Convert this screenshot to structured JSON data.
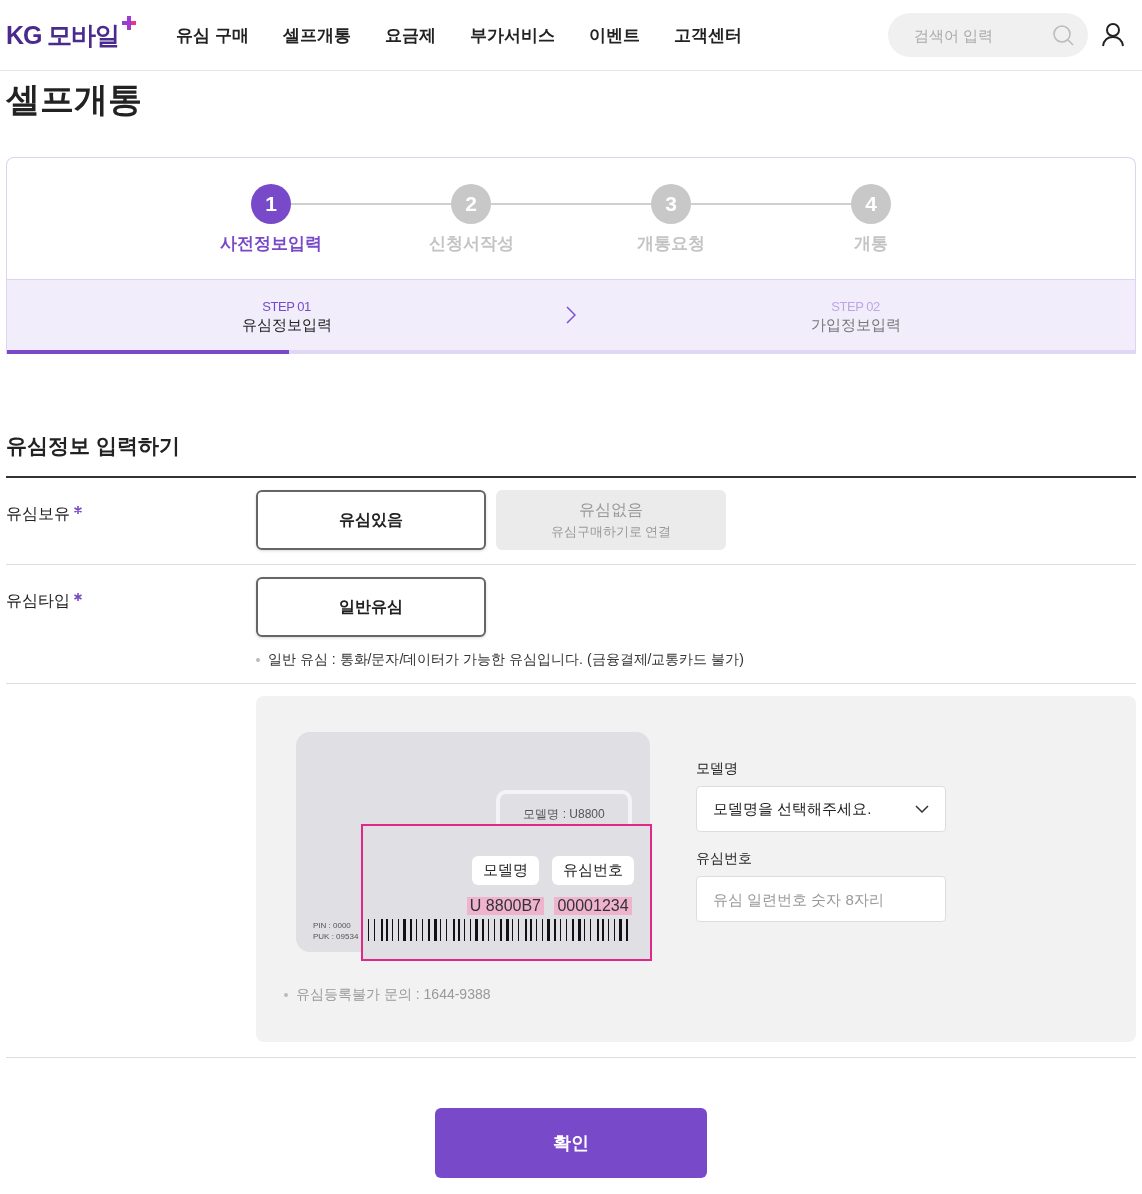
{
  "header": {
    "logo": {
      "text": "KG 모바일"
    },
    "nav": [
      {
        "label": "유심 구매"
      },
      {
        "label": "셀프개통"
      },
      {
        "label": "요금제"
      },
      {
        "label": "부가서비스"
      },
      {
        "label": "이벤트"
      },
      {
        "label": "고객센터"
      }
    ],
    "search": {
      "placeholder": "검색어 입력"
    }
  },
  "page_title": "셀프개통",
  "steps": [
    {
      "number": "1",
      "label": "사전정보입력",
      "selected": true
    },
    {
      "number": "2",
      "label": "신청서작성",
      "selected": false
    },
    {
      "number": "3",
      "label": "개통요청",
      "selected": false
    },
    {
      "number": "4",
      "label": "개통",
      "selected": false
    }
  ],
  "substeps": {
    "level": 0.25,
    "items": [
      {
        "step": "STEP 01",
        "label": "유심정보입력",
        "selected": true
      },
      {
        "step": "STEP 02",
        "label": "가입정보입력",
        "selected": false
      }
    ]
  },
  "section_title": "유심정보 입력하기",
  "form_rows": [
    {
      "label": "유심보유",
      "required": true,
      "options": [
        {
          "label": "유심있음",
          "selected": true,
          "disabled": false
        },
        {
          "label": "유심없음",
          "sublabel": "유심구매하기로 연결",
          "selected": false,
          "disabled": true
        }
      ]
    },
    {
      "label": "유심타입",
      "required": true,
      "options": [
        {
          "label": "일반유심",
          "selected": true,
          "disabled": false
        }
      ],
      "note": "일반 유심 : 통화/문자/데이터가 가능한 유심입니다. (금융결제/교통카드 불가)"
    }
  ],
  "sim_guide": {
    "card": {
      "chip_text": "모델명 : U8800",
      "pin": "PIN : 0000",
      "puk": "PUK : 09534",
      "callouts": [
        {
          "label": "모델명",
          "value": "U 8800B7"
        },
        {
          "label": "유심번호",
          "value": "00001234"
        }
      ]
    },
    "fields": [
      {
        "kind": "select",
        "label": "모델명",
        "value": "모델명을 선택해주세요."
      },
      {
        "kind": "input",
        "label": "유심번호",
        "placeholder": "유심 일련번호 숫자 8자리"
      }
    ],
    "note": "유심등록불가 문의 : 1644-9388"
  },
  "confirm_button": "확인"
}
